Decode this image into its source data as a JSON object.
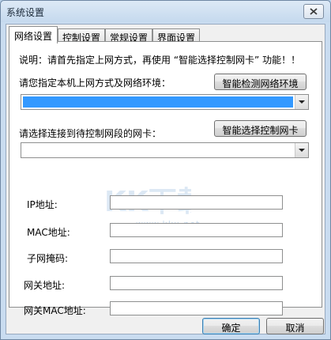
{
  "window": {
    "title": "系统设置"
  },
  "tabs": [
    {
      "label": "网络设置",
      "active": true
    },
    {
      "label": "控制设置",
      "active": false
    },
    {
      "label": "常规设置",
      "active": false
    },
    {
      "label": "界面设置",
      "active": false
    }
  ],
  "panel": {
    "note": "说明：请首先指定上网方式，再使用 “智能选择控制网卡” 功能！！",
    "network_env_label": "请您指定本机上网方式及网络环境：",
    "detect_button": "智能检测网络环境",
    "nic_label": "请选择连接到待控制网段的网卡：",
    "select_nic_button": "智能选择控制网卡",
    "fields": [
      {
        "label": "IP地址:",
        "value": ""
      },
      {
        "label": "MAC地址:",
        "value": ""
      },
      {
        "label": "子网掩码:",
        "value": ""
      },
      {
        "label": "网关地址:",
        "value": ""
      },
      {
        "label": "网关MAC地址:",
        "value": ""
      }
    ]
  },
  "footer": {
    "ok_label": "确定",
    "cancel_label": "取消"
  },
  "watermark": {
    "logo": "KK下载",
    "url": "www.kkx.net"
  },
  "colors": {
    "selection": "#3399ff",
    "titlebar": "#c5d9ee",
    "watermark": "#c7dbee"
  }
}
